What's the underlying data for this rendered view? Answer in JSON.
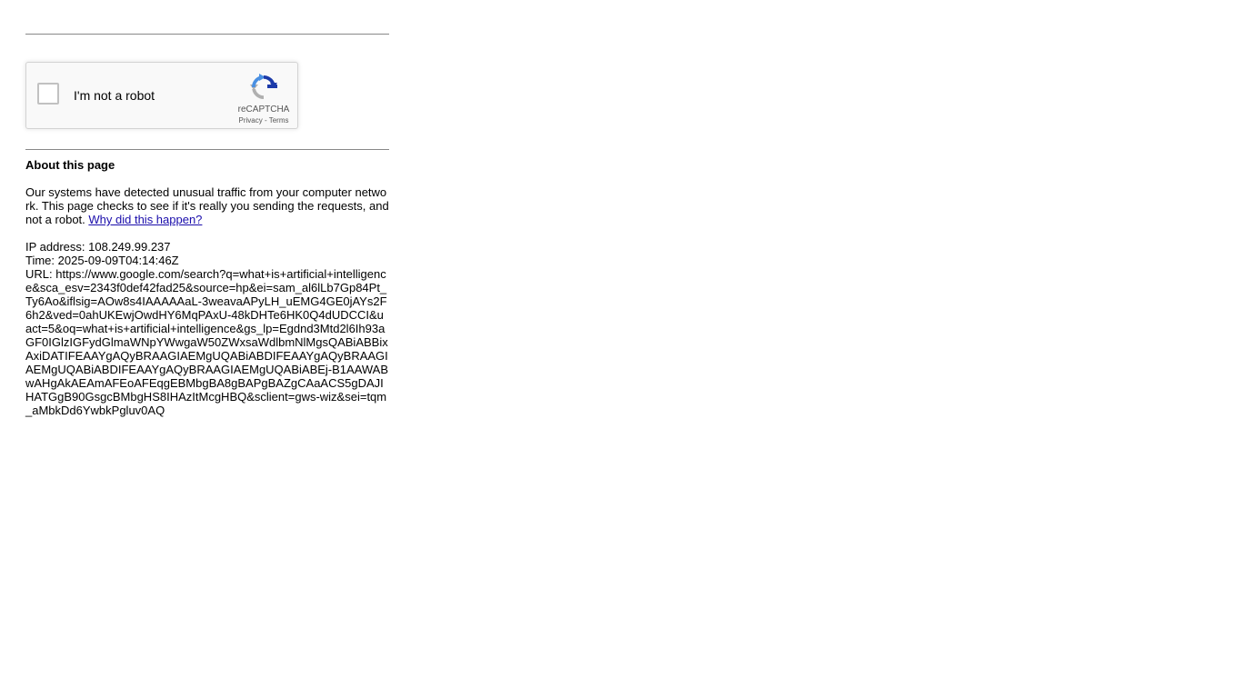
{
  "recaptcha": {
    "checkbox_label": "I'm not a robot",
    "brand": "reCAPTCHA",
    "privacy_link": "Privacy",
    "separator": " - ",
    "terms_link": "Terms",
    "logo_icon": "recaptcha-logo-icon",
    "colors": {
      "blue": "#1c3aa9",
      "light_blue": "#4a90e2",
      "grey": "#b0b0b0"
    }
  },
  "about": {
    "title": "About this page",
    "text": "Our systems have detected unusual traffic from your computer network. This page checks to see if it's really you sending the requests, and not a robot. ",
    "link": "Why did this happen?"
  },
  "info": {
    "ip_label": "IP address: ",
    "ip": "108.249.99.237",
    "time_label": "Time: ",
    "time": "2025-09-09T04:14:46Z",
    "url_label": "URL: ",
    "url": "https://www.google.com/search?q=what+is+artificial+intelligence&sca_esv=2343f0def42fad25&source=hp&ei=sam_al6lLb7Gp84Pt_Ty6Ao&iflsig=AOw8s4IAAAAAaL-3weavaAPyLH_uEMG4GE0jAYs2F6h2&ved=0ahUKEwjOwdHY6MqPAxU-48kDHTe6HK0Q4dUDCCI&uact=5&oq=what+is+artificial+intelligence&gs_lp=Egdnd3Mtd2l6Ih93aGF0IGlzIGFydGlmaWNpYWwgaW50ZWxsaWdlbmNlMgsQABiABBixAxiDATIFEAAYgAQyBRAAGIAEMgUQABiABDIFEAAYgAQyBRAAGIAEMgUQABiABDIFEAAYgAQyBRAAGIAEMgUQABiABEj-B1AAWABwAHgAkAEAmAFEoAFEqgEBMbgBA8gBAPgBAZgCAaACS5gDAJIHATGgB90GsgcBMbgHS8IHAzItMcgHBQ&sclient=gws-wiz&sei=tqm_aMbkDd6YwbkPgluv0AQ"
  },
  "colors": {
    "link": "#1a0dab",
    "rule": "#888888",
    "text": "#000000"
  }
}
